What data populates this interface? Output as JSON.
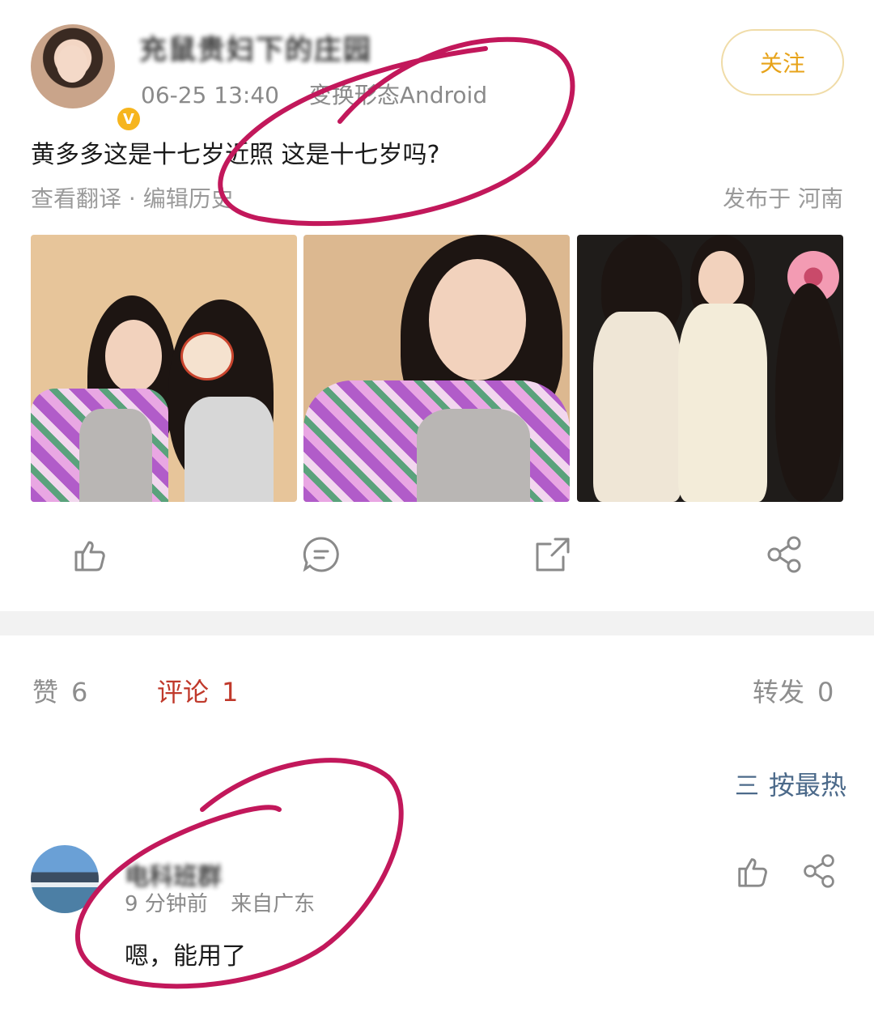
{
  "post": {
    "username": "充鼠贵妇下的庄园",
    "time": "06-25 13:40",
    "source": "变换形态Android",
    "follow_label": "关注",
    "text": "黄多多这是十七岁近照 这是十七岁吗?",
    "translate_link": "查看翻译 · 编辑历史",
    "location": "发布于 河南",
    "photos": [
      "photo-1",
      "photo-2",
      "photo-3"
    ],
    "icons": {
      "like": "thumbs-up-icon",
      "comment": "comment-icon",
      "repost": "repost-icon",
      "share": "share-icon"
    }
  },
  "stats": {
    "like_label": "赞",
    "like_count": "6",
    "comment_label": "评论",
    "comment_count": "1",
    "repost_label": "转发",
    "repost_count": "0"
  },
  "sort": {
    "icon": "sort-icon",
    "label": "按最热"
  },
  "comment": {
    "username": "电科班群",
    "time": "9 分钟前",
    "location": "来自广东",
    "text": "嗯，能用了"
  },
  "colors": {
    "accent_red": "#c0392b",
    "follow_gold": "#e7a31a",
    "annotation": "#c2185b",
    "sort_blue": "#4c6a8a"
  }
}
